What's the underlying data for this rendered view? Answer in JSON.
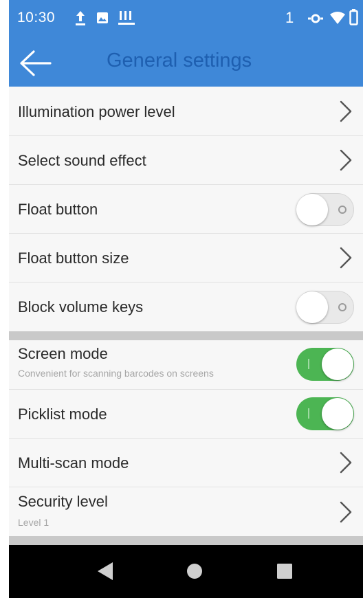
{
  "status_bar": {
    "time": "10:30",
    "sim_slot": "1",
    "icons": [
      "upload-icon",
      "photo-icon",
      "alert-icon",
      "data-sync-icon",
      "wifi-icon",
      "battery-icon"
    ]
  },
  "toolbar": {
    "back_icon": "arrow-left-icon",
    "title": "General settings"
  },
  "settings": {
    "illumination": {
      "title": "Illumination power level"
    },
    "sound": {
      "title": "Select sound effect"
    },
    "float_button": {
      "title": "Float button",
      "enabled": false
    },
    "float_size": {
      "title": "Float button size"
    },
    "block_volume": {
      "title": "Block volume keys",
      "enabled": false
    },
    "screen_mode": {
      "title": "Screen mode",
      "subtitle": "Convenient for scanning barcodes on screens",
      "enabled": true
    },
    "picklist": {
      "title": "Picklist mode",
      "enabled": true
    },
    "multiscan": {
      "title": "Multi-scan mode"
    },
    "security": {
      "title": "Security level",
      "subtitle": "Level 1"
    }
  },
  "nav_bar": {
    "icons": [
      "nav-back-icon",
      "nav-home-icon",
      "nav-recents-icon"
    ]
  },
  "colors": {
    "primary": "#3f88d8",
    "title_text": "#1e5fb0",
    "toggle_on": "#4cb553",
    "list_background": "#f7f7f7",
    "section_divider": "#c9c9c9",
    "nav_bar": "#000000"
  }
}
